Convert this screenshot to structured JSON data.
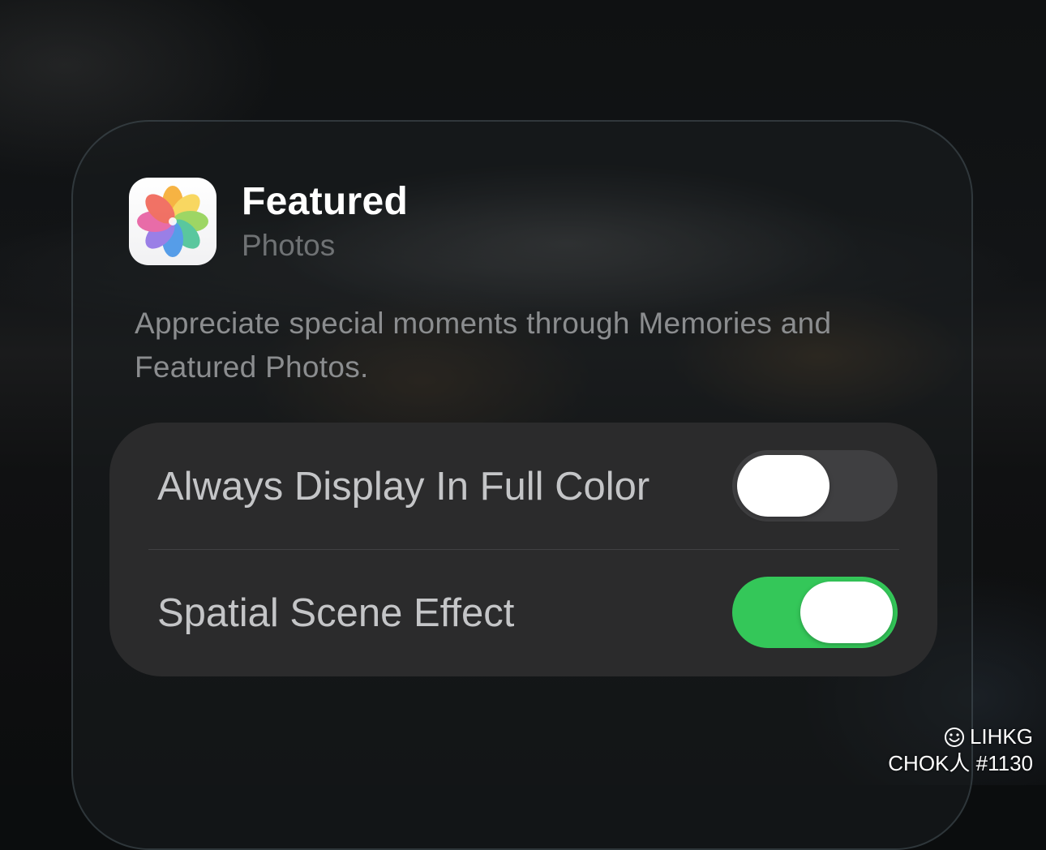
{
  "widget": {
    "app_icon": "photos-app-icon",
    "title": "Featured",
    "subtitle": "Photos",
    "description": "Appreciate special moments through Memories and Featured Photos."
  },
  "settings": [
    {
      "label": "Always Display In Full Color",
      "enabled": false
    },
    {
      "label": "Spatial Scene Effect",
      "enabled": true
    }
  ],
  "colors": {
    "toggle_on": "#34c759",
    "toggle_off": "#3f3f41"
  },
  "watermark": {
    "icon": "smiley-icon",
    "line1": "LIHKG",
    "line2": "CHOK人 #1130"
  }
}
